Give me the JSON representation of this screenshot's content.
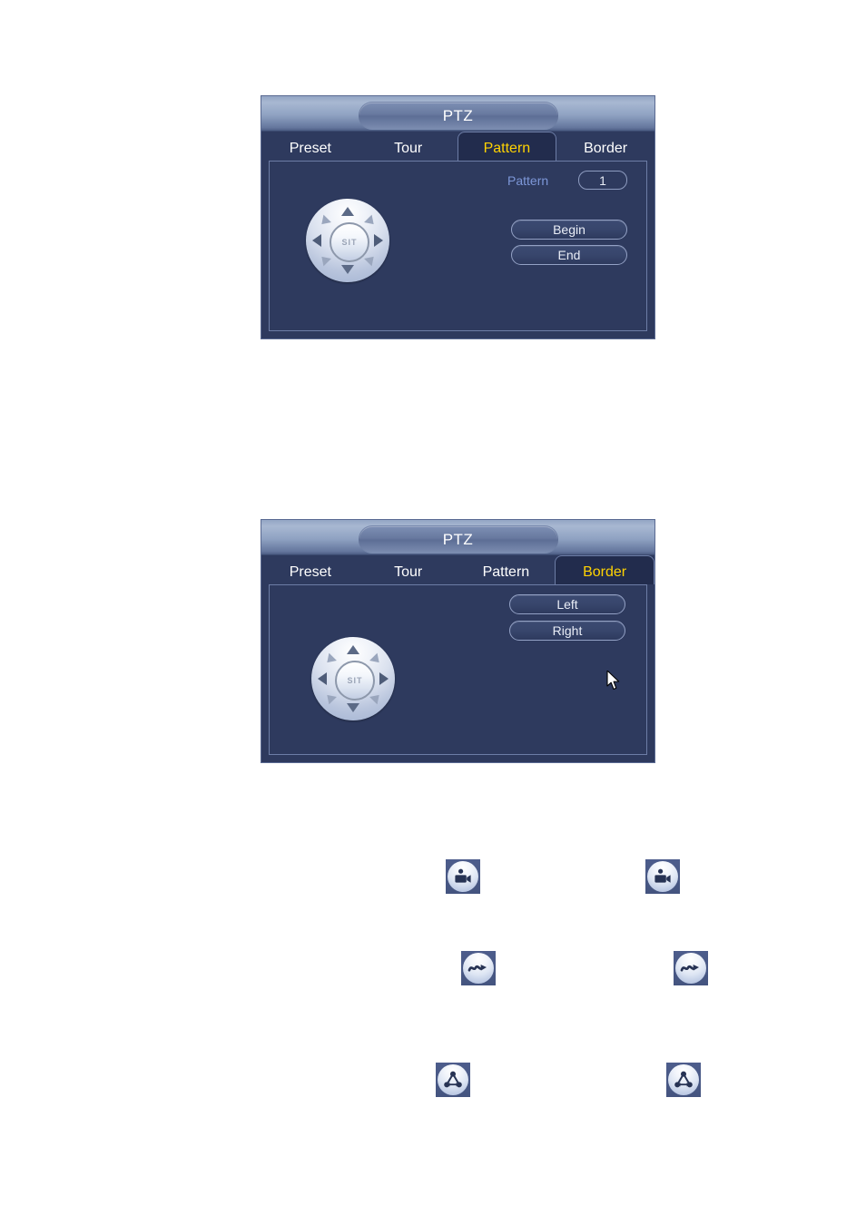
{
  "dialogs": [
    {
      "title": "PTZ",
      "tabs": [
        {
          "label": "Preset",
          "active": false
        },
        {
          "label": "Tour",
          "active": false
        },
        {
          "label": "Pattern",
          "active": true
        },
        {
          "label": "Border",
          "active": false
        }
      ],
      "joystick": {
        "center_label": "SIT"
      },
      "field_label": "Pattern",
      "field_value": "1",
      "buttons": [
        {
          "label": "Begin"
        },
        {
          "label": "End"
        }
      ]
    },
    {
      "title": "PTZ",
      "tabs": [
        {
          "label": "Preset",
          "active": false
        },
        {
          "label": "Tour",
          "active": false
        },
        {
          "label": "Pattern",
          "active": false
        },
        {
          "label": "Border",
          "active": true
        }
      ],
      "joystick": {
        "center_label": "SIT"
      },
      "buttons": [
        {
          "label": "Left"
        },
        {
          "label": "Right"
        }
      ]
    }
  ],
  "icon_rows": [
    {
      "name": "camera-record-icon"
    },
    {
      "name": "wave-arrow-icon"
    },
    {
      "name": "network-nodes-icon"
    }
  ],
  "colors": {
    "panel_bg": "#2e3a5e",
    "active_tab_bg": "#222c4d",
    "active_tab_text": "#ffd302",
    "tab_text": "#ffffff",
    "field_label_text": "#7d97d8",
    "button_text": "#e9edf6",
    "icon_button_bg": "#4d5d8c",
    "icon_glyph": "#273354"
  }
}
